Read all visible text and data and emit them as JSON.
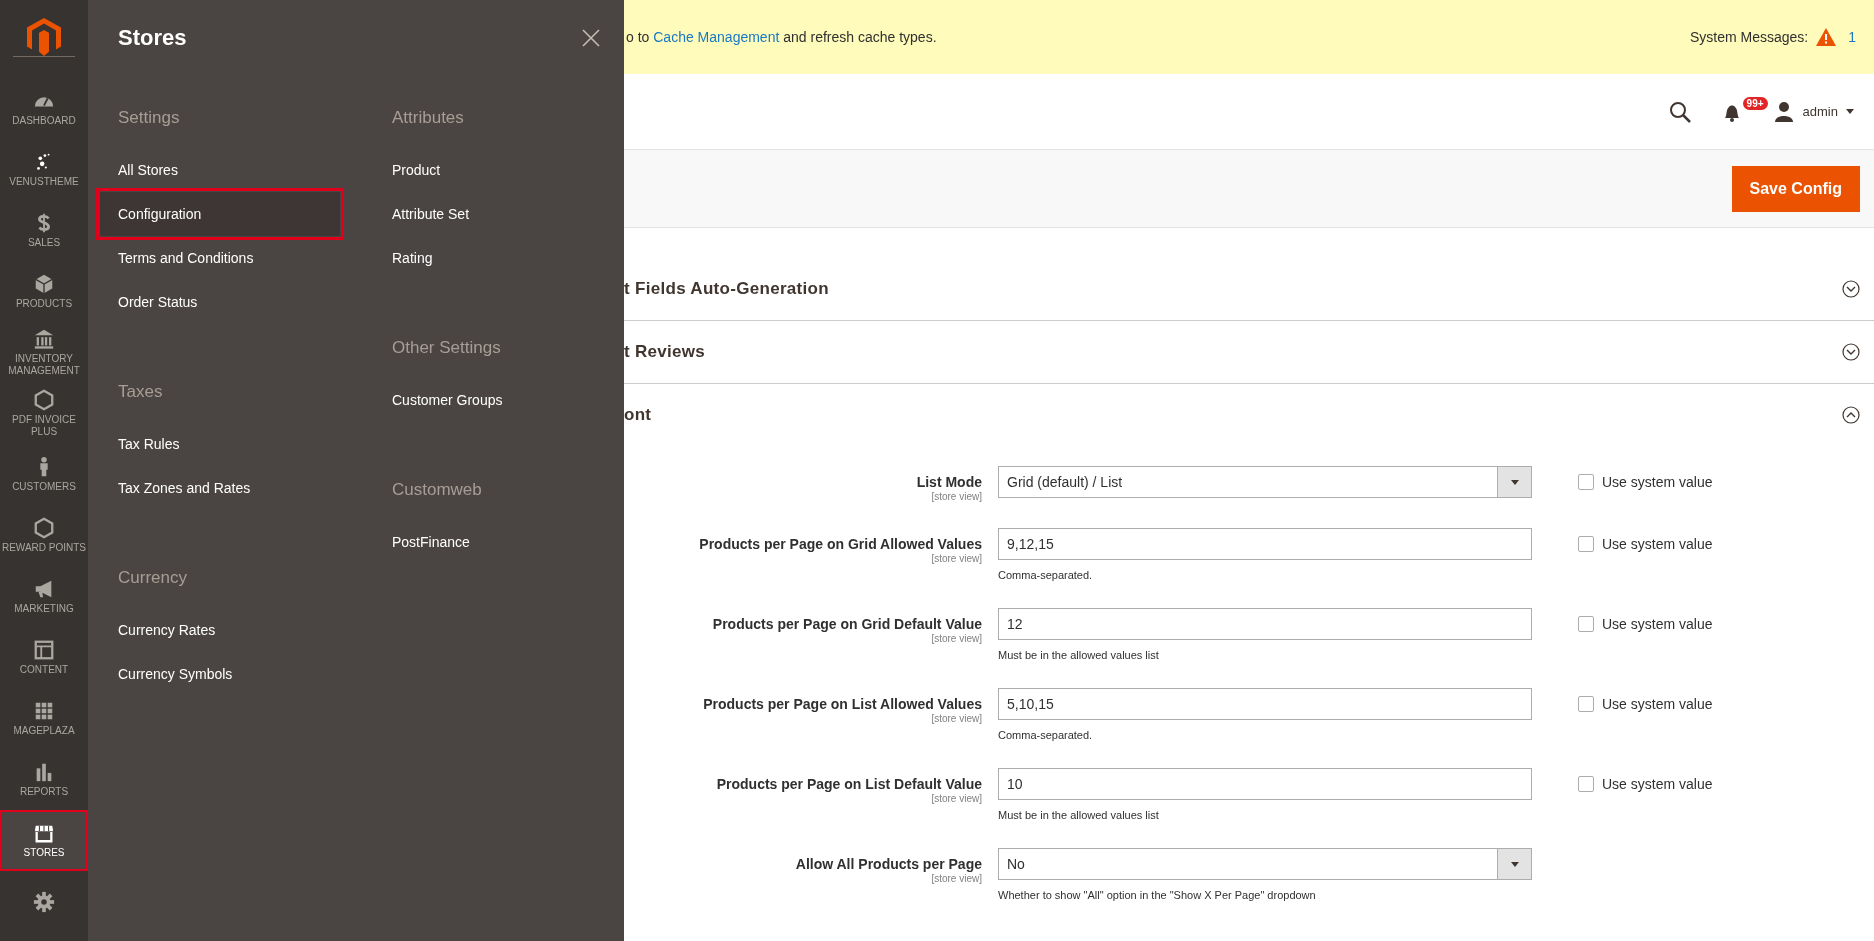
{
  "sidebar": {
    "items": [
      {
        "label": "DASHBOARD",
        "selected": false
      },
      {
        "label": "VENUSTHEME",
        "selected": false
      },
      {
        "label": "SALES",
        "selected": false
      },
      {
        "label": "PRODUCTS",
        "selected": false
      },
      {
        "label": "INVENTORY MANAGEMENT",
        "selected": false
      },
      {
        "label": "PDF INVOICE PLUS",
        "selected": false
      },
      {
        "label": "CUSTOMERS",
        "selected": false
      },
      {
        "label": "REWARD POINTS",
        "selected": false
      },
      {
        "label": "MARKETING",
        "selected": false
      },
      {
        "label": "CONTENT",
        "selected": false
      },
      {
        "label": "MAGEPLAZA",
        "selected": false
      },
      {
        "label": "REPORTS",
        "selected": false
      },
      {
        "label": "STORES",
        "selected": true
      },
      {
        "selected": false
      }
    ]
  },
  "flyout": {
    "title": "Stores",
    "columns": [
      [
        {
          "heading": "Settings",
          "items": [
            {
              "label": "All Stores",
              "selected": false
            },
            {
              "label": "Configuration",
              "selected": true
            },
            {
              "label": "Terms and Conditions",
              "selected": false
            },
            {
              "label": "Order Status",
              "selected": false
            }
          ]
        },
        {
          "heading": "Taxes",
          "items": [
            {
              "label": "Tax Rules",
              "selected": false
            },
            {
              "label": "Tax Zones and Rates",
              "selected": false
            }
          ]
        },
        {
          "heading": "Currency",
          "items": [
            {
              "label": "Currency Rates",
              "selected": false
            },
            {
              "label": "Currency Symbols",
              "selected": false
            }
          ]
        }
      ],
      [
        {
          "heading": "Attributes",
          "items": [
            {
              "label": "Product",
              "selected": false
            },
            {
              "label": "Attribute Set",
              "selected": false
            },
            {
              "label": "Rating",
              "selected": false
            }
          ]
        },
        {
          "heading": "Other Settings",
          "items": [
            {
              "label": "Customer Groups",
              "selected": false
            }
          ]
        },
        {
          "heading": "Customweb",
          "items": [
            {
              "label": "PostFinance",
              "selected": false
            }
          ]
        }
      ]
    ]
  },
  "message_bar": {
    "text_before": "o to ",
    "link": "Cache Management",
    "text_after": " and refresh cache types.",
    "system_messages_label": "System Messages:",
    "system_messages_count": "1"
  },
  "header": {
    "notifications_badge": "99+",
    "user": "admin"
  },
  "actions": {
    "save_button": "Save Config"
  },
  "sections": [
    {
      "title": "t Fields Auto-Generation",
      "expanded": false
    },
    {
      "title": "t Reviews",
      "expanded": false
    },
    {
      "title": "ont",
      "expanded": true
    }
  ],
  "fields": [
    {
      "kind": "select",
      "label": "List Mode",
      "scope": "[store view]",
      "value": "Grid (default) / List",
      "use_system": {
        "label": "Use system value",
        "checked": false
      }
    },
    {
      "kind": "text",
      "label": "Products per Page on Grid Allowed Values",
      "scope": "[store view]",
      "value": "9,12,15",
      "note": "Comma-separated.",
      "use_system": {
        "label": "Use system value",
        "checked": false
      }
    },
    {
      "kind": "text",
      "label": "Products per Page on Grid Default Value",
      "scope": "[store view]",
      "value": "12",
      "note": "Must be in the allowed values list",
      "use_system": {
        "label": "Use system value",
        "checked": false
      }
    },
    {
      "kind": "text",
      "label": "Products per Page on List Allowed Values",
      "scope": "[store view]",
      "value": "5,10,15",
      "note": "Comma-separated.",
      "use_system": {
        "label": "Use system value",
        "checked": false
      }
    },
    {
      "kind": "text",
      "label": "Products per Page on List Default Value",
      "scope": "[store view]",
      "value": "10",
      "note": "Must be in the allowed values list",
      "use_system": {
        "label": "Use system value",
        "checked": false
      }
    },
    {
      "kind": "select",
      "label": "Allow All Products per Page",
      "scope": "[store view]",
      "value": "No",
      "note": "Whether to show \"All\" option in the \"Show X Per Page\" dropdown"
    }
  ]
}
